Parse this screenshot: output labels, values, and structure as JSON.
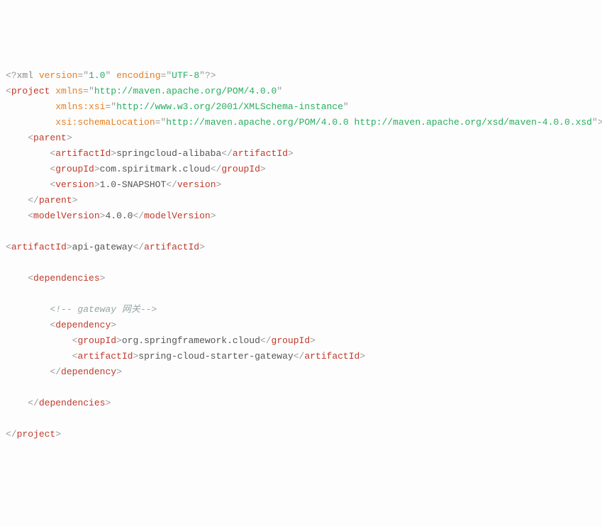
{
  "xmlDecl": {
    "open": "<?",
    "name": "xml",
    "sp1": " ",
    "a1": "version",
    "eq": "=",
    "q": "\"",
    "v1": "1.0",
    "sp2": " ",
    "a2": "encoding",
    "v2": "UTF-8",
    "close": "?>"
  },
  "project": {
    "open": "<",
    "close": ">",
    "slash": "/",
    "name": "project",
    "sp": " ",
    "a_xmlns": "xmlns",
    "v_xmlns": "http://maven.apache.org/POM/4.0.0",
    "indent2": "         ",
    "a_xsi": "xmlns:xsi",
    "v_xsi": "http://www.w3.org/2001/XMLSchema-instance",
    "a_schema": "xsi:schemaLocation",
    "v_schema1": "http://maven.apache.org/POM/4.0.0 ",
    "v_schema2": "http://maven.apache.org/xsd/maven-4.0.0.xsd"
  },
  "parent": {
    "name": "parent",
    "artifactIdTag": "artifactId",
    "artifactIdVal": "springcloud-alibaba",
    "groupIdTag": "groupId",
    "groupIdVal": "com.spiritmark.cloud",
    "versionTag": "version",
    "versionVal": "1.0-SNAPSHOT"
  },
  "modelVersion": {
    "tag": "modelVersion",
    "val": "4.0.0"
  },
  "artifactId": {
    "tag": "artifactId",
    "val": "api-gateway"
  },
  "dependencies": {
    "tag": "dependencies",
    "comment": "<!-- gateway 网关-->",
    "dep": {
      "tag": "dependency",
      "groupIdTag": "groupId",
      "groupIdVal": "org.springframework.cloud",
      "artifactIdTag": "artifactId",
      "artifactIdVal": "spring-cloud-starter-gateway"
    }
  },
  "ind": {
    "i0": "",
    "i1": "    ",
    "i2": "        ",
    "i3": "            "
  }
}
